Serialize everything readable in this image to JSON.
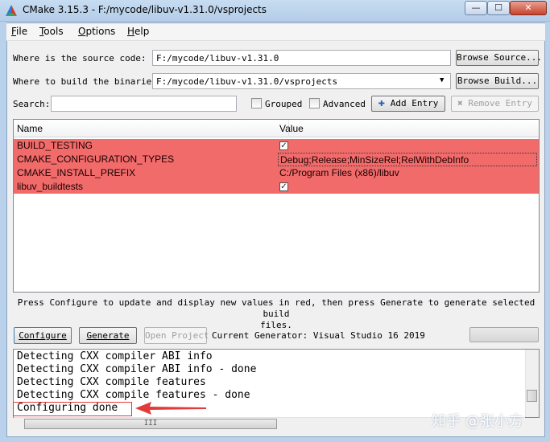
{
  "window": {
    "title": "CMake 3.15.3 - F:/mycode/libuv-v1.31.0/vsprojects",
    "min_glyph": "—",
    "max_glyph": "☐",
    "close_glyph": "✕"
  },
  "menu": [
    {
      "ul": "F",
      "rest": "ile"
    },
    {
      "ul": "T",
      "rest": "ools"
    },
    {
      "ul": "O",
      "rest": "ptions"
    },
    {
      "ul": "H",
      "rest": "elp"
    }
  ],
  "source": {
    "label": "Where is the source code:",
    "value": "F:/mycode/libuv-v1.31.0",
    "browse": "Browse Source..."
  },
  "build": {
    "label": "Where to build the binaries:",
    "value": "F:/mycode/libuv-v1.31.0/vsprojects",
    "browse": "Browse Build..."
  },
  "search": {
    "label": "Search:",
    "value": "",
    "grouped": "Grouped",
    "advanced": "Advanced",
    "add_entry": "Add Entry",
    "remove_entry": "Remove Entry"
  },
  "table": {
    "headers": [
      "Name",
      "Value"
    ],
    "rows": [
      {
        "name": "BUILD_TESTING",
        "value": "",
        "checked": true
      },
      {
        "name": "CMAKE_CONFIGURATION_TYPES",
        "value": "Debug;Release;MinSizeRel;RelWithDebInfo",
        "checked": false
      },
      {
        "name": "CMAKE_INSTALL_PREFIX",
        "value": "C:/Program Files (x86)/libuv",
        "checked": false
      },
      {
        "name": "libuv_buildtests",
        "value": "",
        "checked": true
      }
    ]
  },
  "hint_line1": "Press Configure to update and display new values in red, then press Generate to generate selected build",
  "hint_line2": "files.",
  "actions": {
    "configure": "Configure",
    "generate": "Generate",
    "open_project": "Open Project",
    "generator_label": "Current Generator: Visual Studio 16 2019"
  },
  "output": [
    "Detecting CXX compiler ABI info",
    "Detecting CXX compiler ABI info - done",
    "Detecting CXX compile features",
    "Detecting CXX compile features - done",
    "Configuring done"
  ],
  "scroll_glyph": "III",
  "watermark": "知乎 @张小方",
  "colors": {
    "changed_row": "#f16b6b",
    "annotation": "#e23b3b"
  }
}
